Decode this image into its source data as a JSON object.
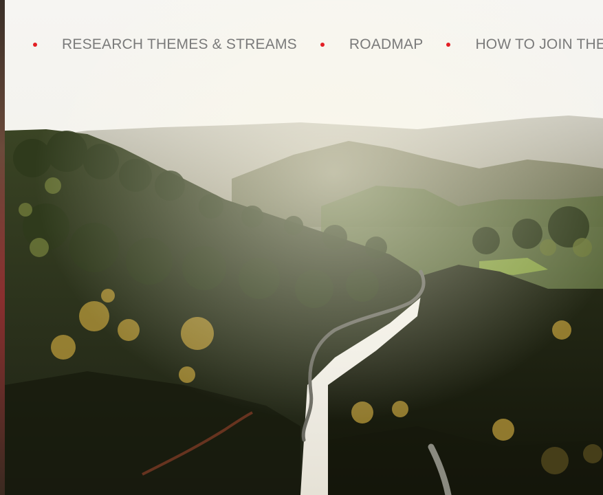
{
  "colors": {
    "bullet": "#e31e24",
    "nav_text": "#7a7a7a",
    "sky": "#f4f3ef"
  },
  "nav": {
    "items": [
      {
        "label": "RESEARCH THEMES & STREAMS",
        "icon": "bullet-dot"
      },
      {
        "label": "ROADMAP",
        "icon": "bullet-dot"
      },
      {
        "label": "HOW TO JOIN THE JOURNEY",
        "icon": "bullet-dot"
      }
    ]
  },
  "hero": {
    "image": "misty forested mountain valley with winding road"
  }
}
